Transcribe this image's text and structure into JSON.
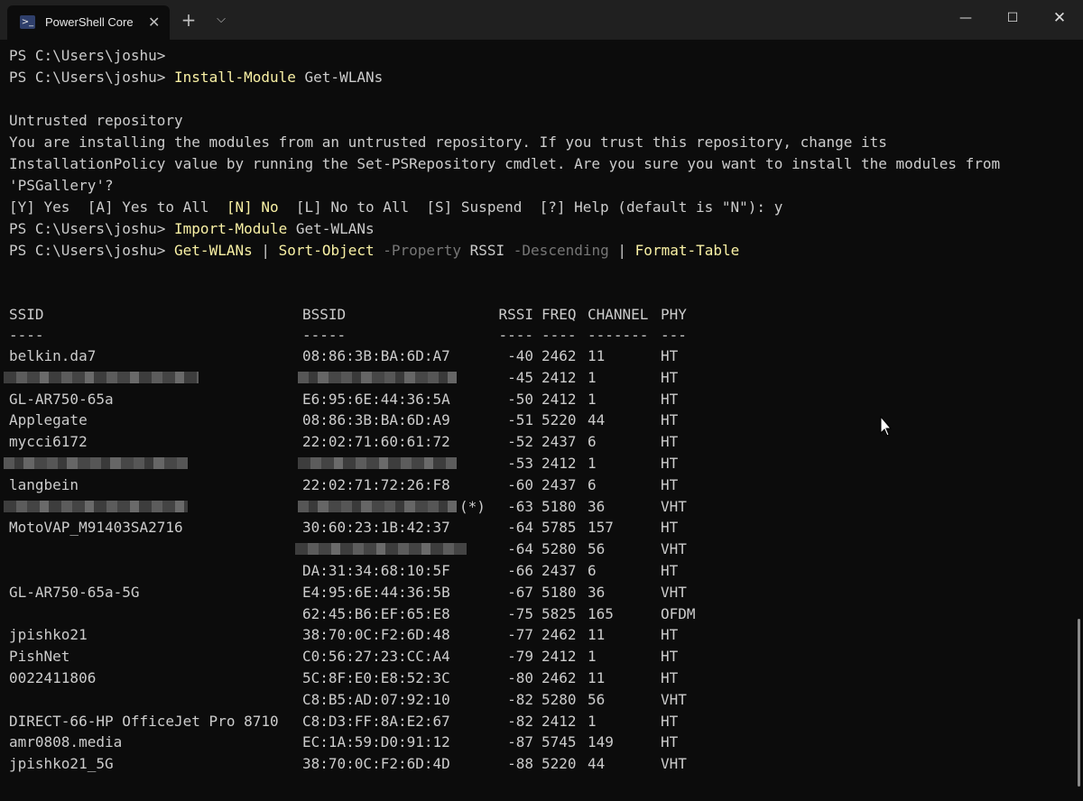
{
  "window": {
    "tab_icon": "powershell-icon",
    "tab_icon_glyph": ">_",
    "tab_title": "PowerShell Core",
    "tab_close": "✕",
    "new_tab": "+",
    "dropdown": "⌵",
    "minimize": "—",
    "maximize": "☐",
    "close": "✕"
  },
  "terminal": {
    "prompt": "PS C:\\Users\\joshu>",
    "cmd_install": "Install-Module",
    "arg_install": "Get-WLANs",
    "warn_title": "Untrusted repository",
    "warn_line1": "You are installing the modules from an untrusted repository. If you trust this repository, change its",
    "warn_line2": "InstallationPolicy value by running the Set-PSRepository cmdlet. Are you sure you want to install the modules from",
    "warn_line3": "'PSGallery'?",
    "choice_a": "[Y] Yes  [A] Yes to All  ",
    "choice_default": "[N] No",
    "choice_b": "  [L] No to All  [S] Suspend  [?] Help (default is \"N\"): y",
    "cmd_import": "Import-Module",
    "arg_import": "Get-WLANs",
    "cmd_get": "Get-WLANs",
    "pipe": "|",
    "cmd_sort": "Sort-Object",
    "param_property": "-Property",
    "arg_rssi": "RSSI",
    "param_desc": "-Descending",
    "cmd_format": "Format-Table"
  },
  "table": {
    "headers": {
      "ssid": "SSID",
      "bssid": "BSSID",
      "rssi": "RSSI",
      "freq": "FREQ",
      "channel": "CHANNEL",
      "phy": "PHY"
    },
    "dashes": {
      "ssid": "----",
      "bssid": "-----",
      "rssi": "----",
      "freq": "----",
      "channel": "-------",
      "phy": "---"
    },
    "rows": [
      {
        "ssid": "belkin.da7",
        "bssid": "08:86:3B:BA:6D:A7",
        "rssi": "-40",
        "freq": "2462",
        "channel": "11",
        "phy": "HT"
      },
      {
        "ssid": "",
        "bssid": "",
        "rssi": "-45",
        "freq": "2412",
        "channel": "1",
        "phy": "HT"
      },
      {
        "ssid": "GL-AR750-65a",
        "bssid": "E6:95:6E:44:36:5A",
        "rssi": "-50",
        "freq": "2412",
        "channel": "1",
        "phy": "HT"
      },
      {
        "ssid": "Applegate",
        "bssid": "08:86:3B:BA:6D:A9",
        "rssi": "-51",
        "freq": "5220",
        "channel": "44",
        "phy": "HT"
      },
      {
        "ssid": "mycci6172",
        "bssid": "22:02:71:60:61:72",
        "rssi": "-52",
        "freq": "2437",
        "channel": "6",
        "phy": "HT"
      },
      {
        "ssid": "",
        "bssid": "",
        "rssi": "-53",
        "freq": "2412",
        "channel": "1",
        "phy": "HT"
      },
      {
        "ssid": "langbein",
        "bssid": "22:02:71:72:26:F8",
        "rssi": "-60",
        "freq": "2437",
        "channel": "6",
        "phy": "HT"
      },
      {
        "ssid": "",
        "bssid": "",
        "marker": "(*)",
        "rssi": "-63",
        "freq": "5180",
        "channel": "36",
        "phy": "VHT"
      },
      {
        "ssid": "MotoVAP_M91403SA2716",
        "bssid": "30:60:23:1B:42:37",
        "rssi": "-64",
        "freq": "5785",
        "channel": "157",
        "phy": "HT"
      },
      {
        "ssid": "",
        "bssid": "",
        "rssi": "-64",
        "freq": "5280",
        "channel": "56",
        "phy": "VHT"
      },
      {
        "ssid": "",
        "bssid": "DA:31:34:68:10:5F",
        "rssi": "-66",
        "freq": "2437",
        "channel": "6",
        "phy": "HT"
      },
      {
        "ssid": "GL-AR750-65a-5G",
        "bssid": "E4:95:6E:44:36:5B",
        "rssi": "-67",
        "freq": "5180",
        "channel": "36",
        "phy": "VHT"
      },
      {
        "ssid": "",
        "bssid": "62:45:B6:EF:65:E8",
        "rssi": "-75",
        "freq": "5825",
        "channel": "165",
        "phy": "OFDM"
      },
      {
        "ssid": "jpishko21",
        "bssid": "38:70:0C:F2:6D:48",
        "rssi": "-77",
        "freq": "2462",
        "channel": "11",
        "phy": "HT"
      },
      {
        "ssid": "PishNet",
        "bssid": "C0:56:27:23:CC:A4",
        "rssi": "-79",
        "freq": "2412",
        "channel": "1",
        "phy": "HT"
      },
      {
        "ssid": "0022411806",
        "bssid": "5C:8F:E0:E8:52:3C",
        "rssi": "-80",
        "freq": "2462",
        "channel": "11",
        "phy": "HT"
      },
      {
        "ssid": "",
        "bssid": "C8:B5:AD:07:92:10",
        "rssi": "-82",
        "freq": "5280",
        "channel": "56",
        "phy": "VHT"
      },
      {
        "ssid": "DIRECT-66-HP OfficeJet Pro 8710",
        "bssid": "C8:D3:FF:8A:E2:67",
        "rssi": "-82",
        "freq": "2412",
        "channel": "1",
        "phy": "HT"
      },
      {
        "ssid": "amr0808.media",
        "bssid": "EC:1A:59:D0:91:12",
        "rssi": "-87",
        "freq": "5745",
        "channel": "149",
        "phy": "HT"
      },
      {
        "ssid": "jpishko21_5G",
        "bssid": "38:70:0C:F2:6D:4D",
        "rssi": "-88",
        "freq": "5220",
        "channel": "44",
        "phy": "VHT"
      }
    ]
  },
  "colors": {
    "background": "#0c0c0c",
    "titlebar": "#202020",
    "text": "#cccccc",
    "command": "#f9f1a5",
    "parameter": "#767676"
  }
}
